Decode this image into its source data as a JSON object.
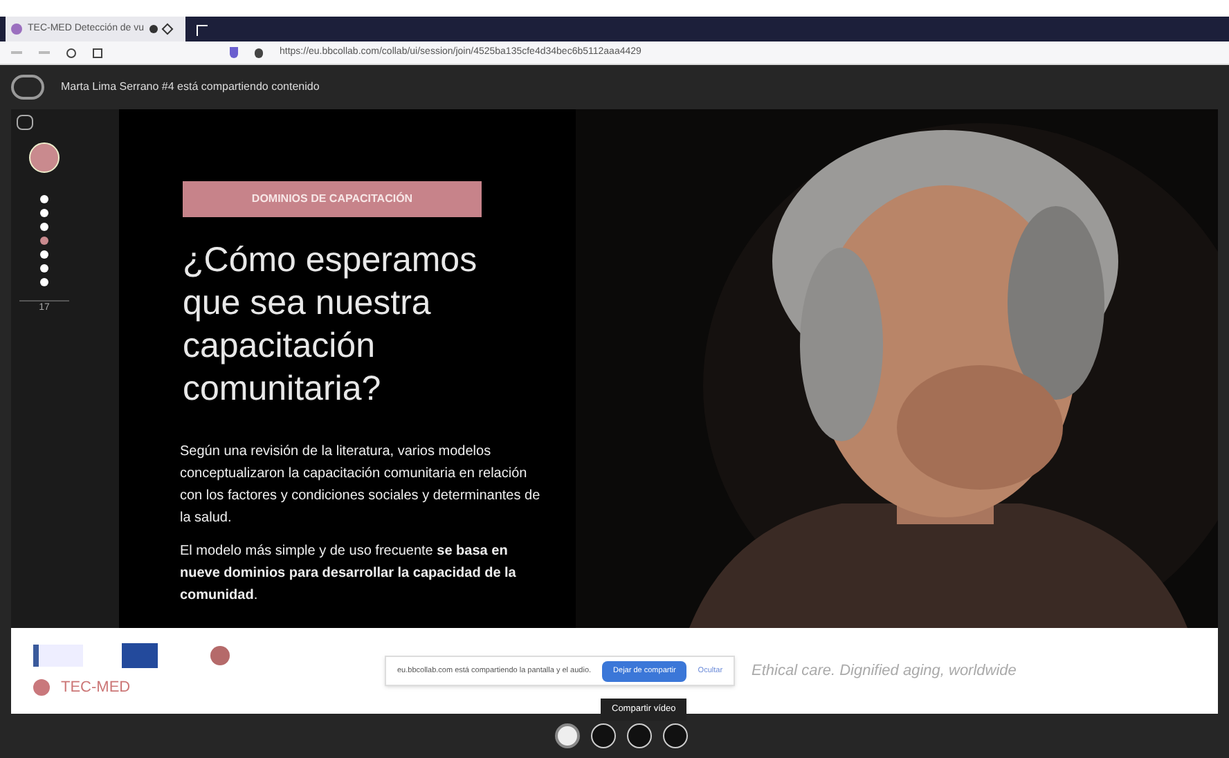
{
  "browser": {
    "tab_title": "TEC-MED Detección de vu",
    "url": "https://eu.bbcollab.com/collab/ui/session/join/4525ba135cfe4d34bec6b5112aaa4429"
  },
  "session": {
    "sharing_notice": "Marta Lima Serrano #4 está compartiendo contenido"
  },
  "slide_nav": {
    "dots": [
      {
        "selected": false
      },
      {
        "selected": false
      },
      {
        "selected": false
      },
      {
        "selected": true
      },
      {
        "selected": false
      },
      {
        "selected": false
      },
      {
        "selected": false
      }
    ],
    "page": "17"
  },
  "slide": {
    "badge": "DOMINIOS DE CAPACITACIÓN",
    "title": "¿Cómo esperamos que sea nuestra capacitación comunitaria?",
    "paragraphs": [
      "Según una revisión de la literatura, varios modelos conceptualizaron la capacitación comunitaria en relación con los factores y condiciones sociales y determinantes de la salud.",
      "El modelo más simple y de uso frecuente **se basa en nueve dominios para desarrollar la capacidad de la comunidad**."
    ],
    "footer": {
      "brand": "TEC-MED",
      "slogan": "Ethical care. Dignified aging, worldwide"
    }
  },
  "share_bar": {
    "message": "eu.bbcollab.com está compartiendo la pantalla y el audio.",
    "stop_button": "Dejar de compartir",
    "hide_link": "Ocultar"
  },
  "toolbar": {
    "tooltip": "Compartir vídeo"
  }
}
